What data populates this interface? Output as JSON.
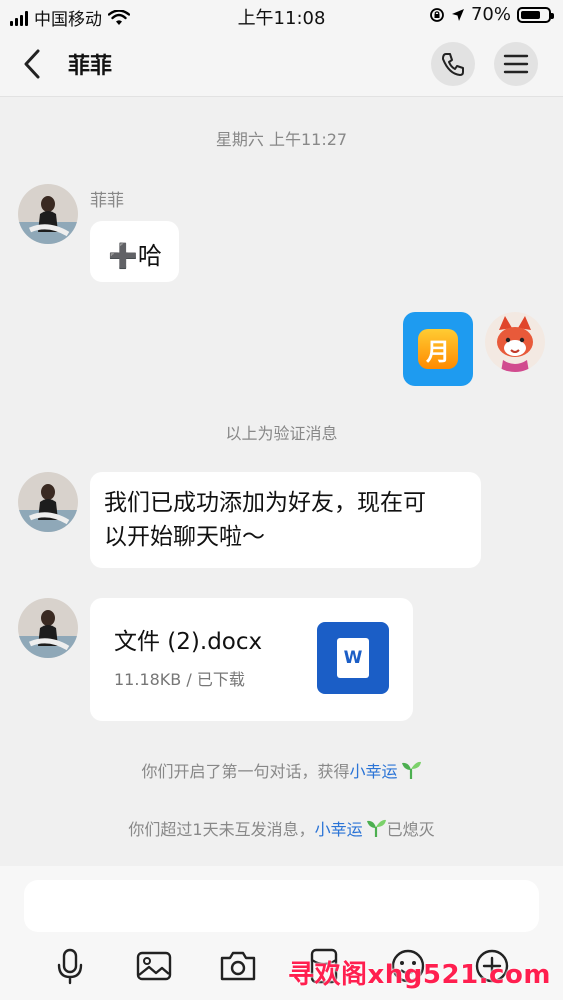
{
  "status_bar": {
    "carrier": "中国移动",
    "time": "上午11:08",
    "battery": "70%",
    "battery_level": 0.7
  },
  "nav": {
    "title": "菲菲",
    "icons": [
      "back-icon",
      "phone-icon",
      "menu-icon"
    ]
  },
  "chat": {
    "timestamp": "星期六 上午11:27",
    "sender_name": "菲菲",
    "msg1": "➕哈",
    "sticker_text": "月",
    "verify_notice": "以上为验证消息",
    "msg2_line1": "我们已成功添加为好友，现在可",
    "msg2_line2": "以开始聊天啦～",
    "file": {
      "name": "文件 (2).docx",
      "meta": "11.18KB / 已下载",
      "icon_letter": "W"
    },
    "notice1_prefix": "你们开启了第一句对话，获得",
    "notice1_link": "小幸运",
    "notice2_prefix": "你们超过1天未互发消息，",
    "notice2_link": "小幸运",
    "notice2_suffix": "已熄灭"
  },
  "input": {
    "placeholder": "",
    "tools": [
      "microphone-icon",
      "image-icon",
      "camera-icon",
      "red-packet-icon",
      "emoji-icon",
      "plus-icon"
    ]
  },
  "watermark": "寻欢阁xhg521.com",
  "colors": {
    "background": "#f0f0f0",
    "link": "#2b74d6",
    "word_blue": "#1b5ec6",
    "sticker_blue": "#1e9bf0",
    "sprout_green": "#4caf50"
  }
}
